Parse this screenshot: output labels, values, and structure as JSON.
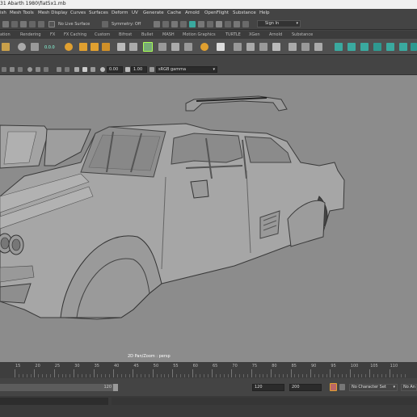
{
  "window": {
    "title": "31 Abarth 1980\\fiat5x1.mb"
  },
  "menu": [
    "ish",
    "Mesh Tools",
    "Mesh Display",
    "Curves",
    "Surfaces",
    "Deform",
    "UV",
    "Generate",
    "Cache",
    "Arnold",
    "OpenFlight",
    "Substance",
    "Help"
  ],
  "status_line": {
    "live_surface": "No Live Surface",
    "symmetry": "Symmetry: Off",
    "sign_in": "Sign In"
  },
  "shelf_tabs": [
    "ation",
    "Rendering",
    "FX",
    "FX Caching",
    "Custom",
    "Bifrost",
    "Bullet",
    "MASH",
    "Motion Graphics",
    "TURTLE",
    "XGen",
    "Arnold",
    "Substance"
  ],
  "shelf": {
    "counter": "0.0.0"
  },
  "panel_toolbar": {
    "value_a": "0.00",
    "value_b": "1.00",
    "colorspace": "sRGB gamma"
  },
  "viewport": {
    "label": "2D Pan/Zoom : persp"
  },
  "timeline": {
    "ticks": [
      "15",
      "20",
      "25",
      "30",
      "35",
      "40",
      "45",
      "50",
      "55",
      "60",
      "65",
      "70",
      "75",
      "80",
      "85",
      "90",
      "95",
      "100",
      "105",
      "110"
    ]
  },
  "range": {
    "current_end": "120",
    "end": "120",
    "max": "200",
    "character_set": "No Character Set",
    "anim_layer": "No An"
  },
  "colors": {
    "accent_teal": "#3aa99f",
    "accent_orange": "#e0a030",
    "viewport_bg": "#8c8c8c"
  }
}
